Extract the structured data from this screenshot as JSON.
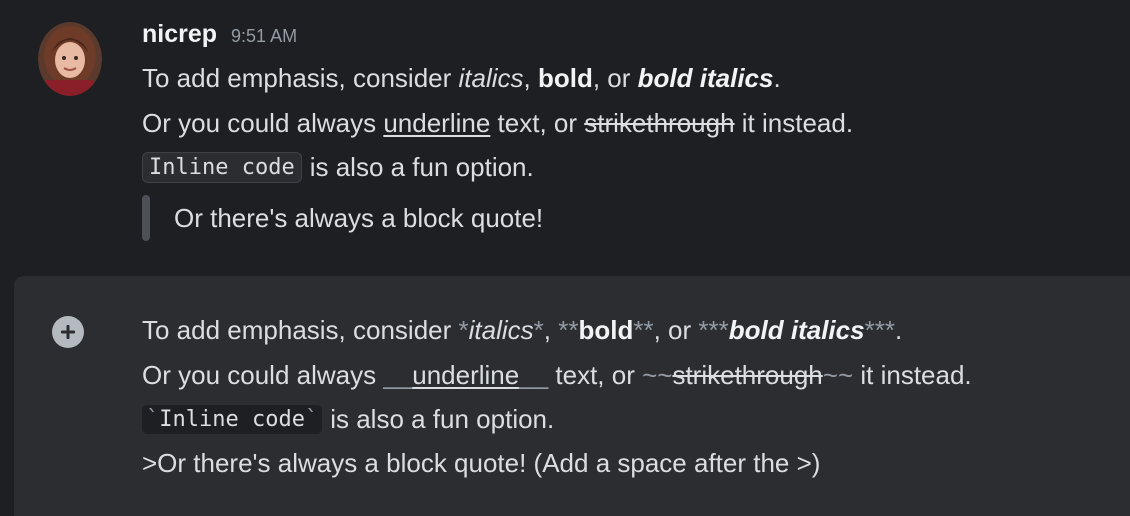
{
  "message": {
    "username": "nicrep",
    "timestamp": "9:51 AM",
    "line1": {
      "prefix": "To add emphasis, consider ",
      "italic": "italics",
      "sep1": ", ",
      "bold": "bold",
      "sep2": ", or ",
      "bold_italic": "bold italics",
      "suffix": "."
    },
    "line2": {
      "prefix": "Or you could always ",
      "underline": "underline",
      "middle": " text, or ",
      "strike": "strikethrough",
      "suffix": " it instead."
    },
    "line3": {
      "code": "Inline code",
      "suffix": "is also a fun option."
    },
    "quote": "Or there's always a block quote!"
  },
  "composer": {
    "line1": {
      "prefix": "To add emphasis, consider ",
      "m_it_open": "*",
      "italic": "italics",
      "m_it_close": "*",
      "sep1": ", ",
      "m_b_open": "**",
      "bold": "bold",
      "m_b_close": "**",
      "sep2": ", or ",
      "m_bi_open": "***",
      "bold_italic": "bold italics",
      "m_bi_close": "***",
      "suffix": "."
    },
    "line2": {
      "prefix": "Or you could always ",
      "m_ul_open": "__",
      "underline": "underline",
      "m_ul_close": "__",
      "middle": " text, or ",
      "m_st_open": "~~",
      "strike": "strikethrough",
      "m_st_close": "~~",
      "suffix": " it instead."
    },
    "line3": {
      "tick_open": "`",
      "code": "Inline code",
      "tick_close": "`",
      "suffix": "is also a fun option."
    },
    "line4": ">Or there's always a block quote! (Add a space after the >)"
  },
  "icons": {
    "add": "plus-circle-icon",
    "avatar": "user-avatar"
  }
}
